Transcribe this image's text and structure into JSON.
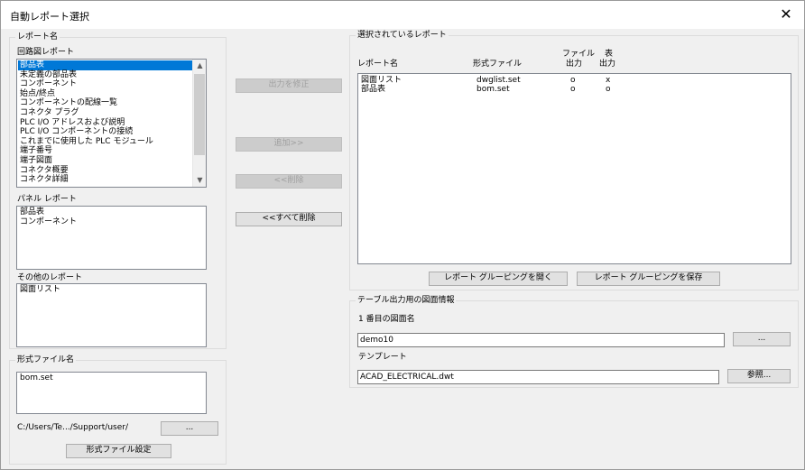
{
  "window": {
    "title": "自動レポート選択",
    "close_label": "✕"
  },
  "left": {
    "report_group_label": "レポート名",
    "schematic": {
      "label": "回路図レポート",
      "items": [
        "部品表",
        "未定義の部品表",
        "コンポーネント",
        "始点/終点",
        "コンポーネントの配線一覧",
        "コネクタ プラグ",
        "PLC I/O アドレスおよび説明",
        "PLC I/O コンポーネントの接続",
        "これまでに使用した PLC モジュール",
        "端子番号",
        "端子図面",
        "コネクタ概要",
        "コネクタ詳細"
      ]
    },
    "panel": {
      "label": "パネル レポート",
      "items": [
        "部品表",
        "コンポーネント"
      ]
    },
    "other": {
      "label": "その他のレポート",
      "items": [
        "図面リスト"
      ]
    },
    "format": {
      "group_label": "形式ファイル名",
      "items": [
        "bom.set"
      ],
      "path": "C:/Users/Te.../Support/user/",
      "browse_label": "...",
      "settings_label": "形式ファイル設定"
    }
  },
  "middle": {
    "edit_output_label": "出力を修正",
    "add_label": "追加>>",
    "remove_label": "<<削除",
    "remove_all_label": "<<すべて削除"
  },
  "right": {
    "selected_group_label": "選択されているレポート",
    "columns": {
      "name": "レポート名",
      "format": "形式ファイル",
      "file_out_1": "ファイル",
      "file_out_2": "出力",
      "table_out_1": "表",
      "table_out_2": "出力"
    },
    "rows": [
      {
        "name": "図面リスト",
        "format": "dwglist.set",
        "file_out": "o",
        "table_out": "x"
      },
      {
        "name": "部品表",
        "format": "bom.set",
        "file_out": "o",
        "table_out": "o"
      }
    ],
    "open_grouping_label": "レポート グルーピングを開く",
    "save_grouping_label": "レポート グルーピングを保存",
    "table_info": {
      "group_label": "テーブル出力用の図面情報",
      "first_drawing_label": "1 番目の図面名",
      "first_drawing_value": "demo10",
      "drawing_browse_label": "...",
      "template_label": "テンプレート",
      "template_value": "ACAD_ELECTRICAL.dwt",
      "browse_label": "参照..."
    }
  }
}
